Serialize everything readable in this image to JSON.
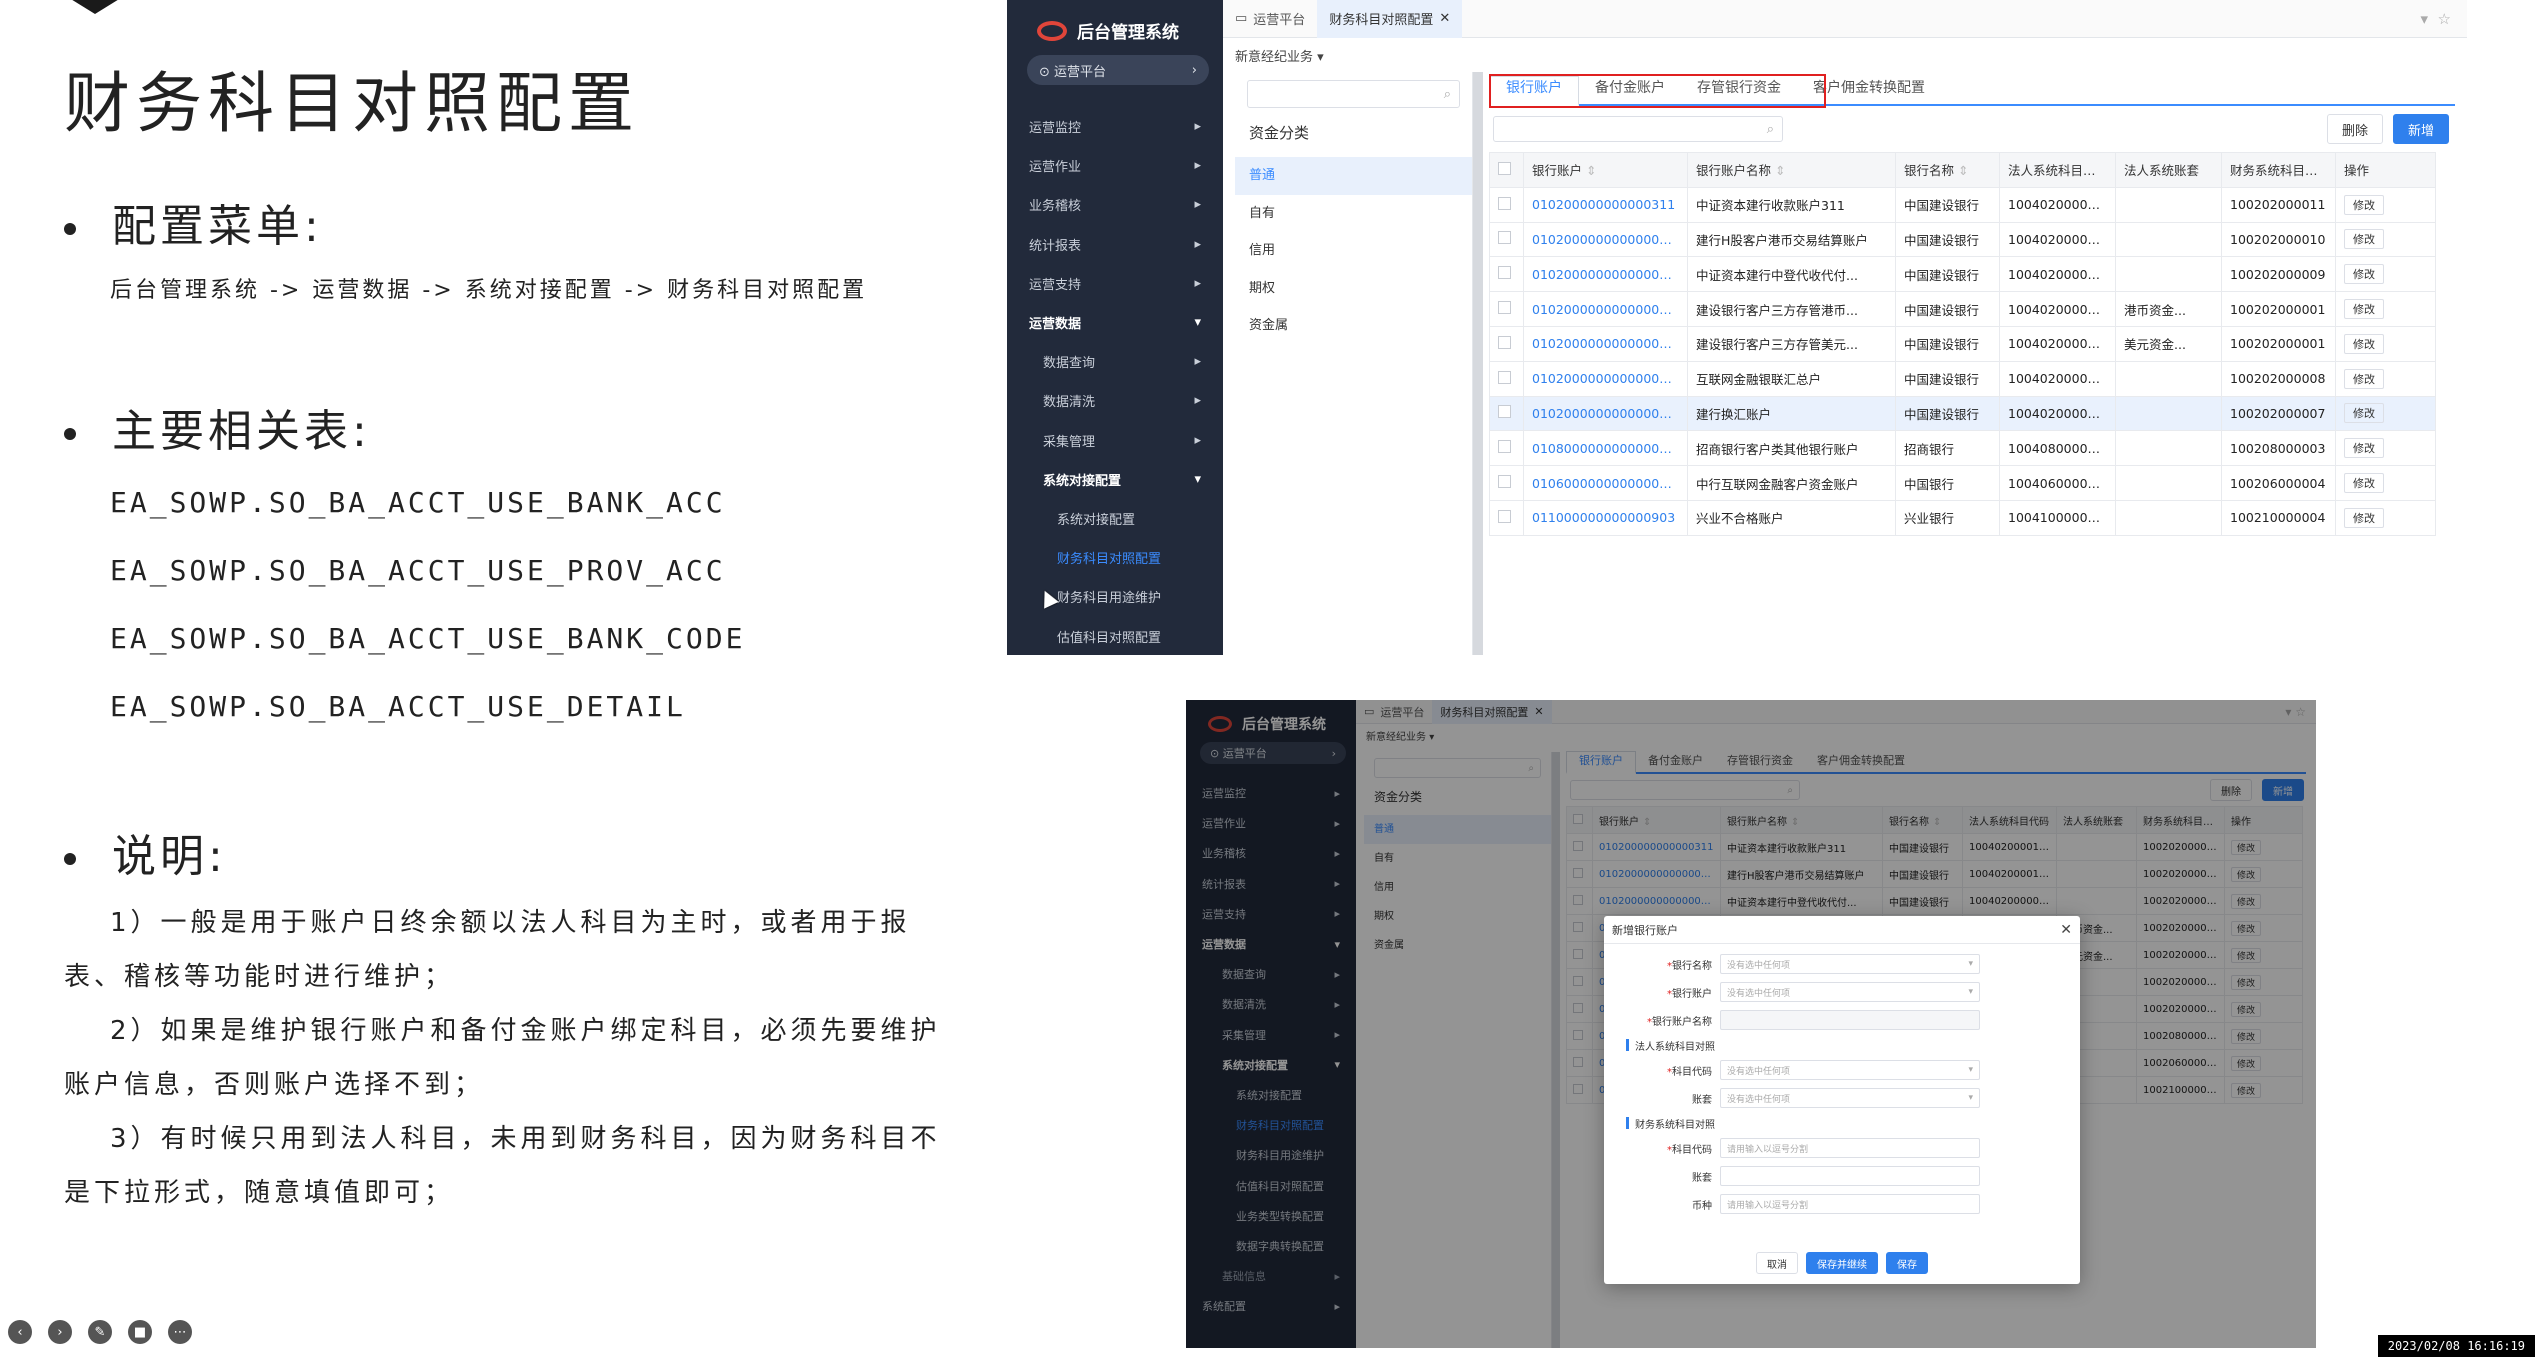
{
  "slide": {
    "title": "财务科目对照配置",
    "section_menu": "配置菜单:",
    "menu_path": "后台管理系统 -> 运营数据 -> 系统对接配置 -> 财务科目对照配置",
    "section_tables": "主要相关表:",
    "tables": [
      "EA_SOWP.SO_BA_ACCT_USE_BANK_ACC",
      "EA_SOWP.SO_BA_ACCT_USE_PROV_ACC",
      "EA_SOWP.SO_BA_ACCT_USE_BANK_CODE",
      "EA_SOWP.SO_BA_ACCT_USE_DETAIL"
    ],
    "section_notes": "说明:",
    "notes": [
      "1）一般是用于账户日终余额以法人科目为主时，或者用于报表、稽核等功能时进行维护；",
      "2）如果是维护银行账户和备付金账户绑定科目，必须先要维护账户信息，否则账户选择不到；",
      "3）有时候只用到法人科目，未用到财务科目，因为财务科目不是下拉形式，随意填值即可；"
    ],
    "timestamp": "2023/02/08 16:16:19"
  },
  "app": {
    "brand": "后台管理系统",
    "platform": "运营平台",
    "tab_home": "运营平台",
    "tab_current": "财务科目对照配置",
    "crumb": "新意经纪业务",
    "menu": [
      {
        "label": "运营监控",
        "kind": "top",
        "arrow": "▸"
      },
      {
        "label": "运营作业",
        "kind": "top",
        "arrow": "▸"
      },
      {
        "label": "业务稽核",
        "kind": "top",
        "arrow": "▸"
      },
      {
        "label": "统计报表",
        "kind": "top",
        "arrow": "▸"
      },
      {
        "label": "运营支持",
        "kind": "top",
        "arrow": "▸"
      },
      {
        "label": "运营数据",
        "kind": "group",
        "arrow": "▾"
      },
      {
        "label": "数据查询",
        "kind": "sub",
        "arrow": "▸"
      },
      {
        "label": "数据清洗",
        "kind": "sub",
        "arrow": "▸"
      },
      {
        "label": "采集管理",
        "kind": "sub",
        "arrow": "▸"
      },
      {
        "label": "系统对接配置",
        "kind": "subgroup",
        "arrow": "▾"
      },
      {
        "label": "系统对接配置",
        "kind": "sub2",
        "arrow": ""
      },
      {
        "label": "财务科目对照配置",
        "kind": "sub2-active",
        "arrow": ""
      },
      {
        "label": "财务科目用途维护",
        "kind": "sub2",
        "arrow": ""
      },
      {
        "label": "估值科目对照配置",
        "kind": "sub2",
        "arrow": ""
      },
      {
        "label": "业务类型转换配置",
        "kind": "sub2",
        "arrow": ""
      },
      {
        "label": "数据字典转换配置",
        "kind": "sub2",
        "arrow": ""
      },
      {
        "label": "基础信息",
        "kind": "sub-dim",
        "arrow": "▸"
      },
      {
        "label": "系统配置",
        "kind": "top",
        "arrow": "▸"
      }
    ],
    "cat_title": "资金分类",
    "categories": [
      "普通",
      "自有",
      "信用",
      "期权",
      "资金属"
    ],
    "subtabs": [
      "银行账户",
      "备付金账户",
      "存管银行资金",
      "客户佣金转换配置"
    ],
    "btn_delete": "删除",
    "btn_add": "新增",
    "columns": [
      "银行账户",
      "银行账户名称",
      "银行名称",
      "法人系统科目代码",
      "法人系统账套",
      "财务系统科目代码",
      "操作"
    ],
    "rows": [
      [
        "010200000000000311",
        "中证资本建行收款账户311",
        "中国建设银行",
        "100402000011...",
        "",
        "100202000011"
      ],
      [
        "01020000000000004...",
        "建行H股客户港币交易结算账户",
        "中国建设银行",
        "100402000010...",
        "",
        "100202000010"
      ],
      [
        "01020000000000003...",
        "中证资本建行中登代收代付...",
        "中国建设银行",
        "100402000009...",
        "",
        "100202000009"
      ],
      [
        "01020000000000001...",
        "建设银行客户三方存管港币...",
        "中国建设银行",
        "100402000001...",
        "港币资金...",
        "100202000001"
      ],
      [
        "01020000000000001...",
        "建设银行客户三方存管美元...",
        "中国建设银行",
        "100402000001...",
        "美元资金...",
        "100202000001"
      ],
      [
        "01020000000000009...",
        "互联网金融银联汇总户",
        "中国建设银行",
        "100402000008...",
        "",
        "100202000008"
      ],
      [
        "01020000000000009...",
        "建行换汇账户",
        "中国建设银行",
        "100402000007...",
        "",
        "100202000007"
      ],
      [
        "01080000000000009...",
        "招商银行客户类其他银行账户",
        "招商银行",
        "100408000003...",
        "",
        "100208000003"
      ],
      [
        "01060000000000009...",
        "中行互联网金融客户资金账户",
        "中国银行",
        "100406000004...",
        "",
        "100206000004"
      ],
      [
        "011000000000000903",
        "兴业不合格账户",
        "兴业银行",
        "100410000004...",
        "",
        "100210000004"
      ]
    ],
    "row_action": "修改",
    "dialog": {
      "title": "新增银行账户",
      "field_bank_name": "银行名称",
      "field_bank_acc": "银行账户",
      "field_bank_acc_name": "银行账户名称",
      "select_placeholder": "没有选中任何项",
      "section_legal": "法人系统科目对照",
      "field_subject_code": "科目代码",
      "field_book": "账套",
      "section_fin": "财务系统科目对照",
      "input_placeholder": "请用输入以逗号分割",
      "field_currency": "币种",
      "btn_cancel": "取消",
      "btn_save_continue": "保存并继续",
      "btn_save": "保存"
    }
  }
}
